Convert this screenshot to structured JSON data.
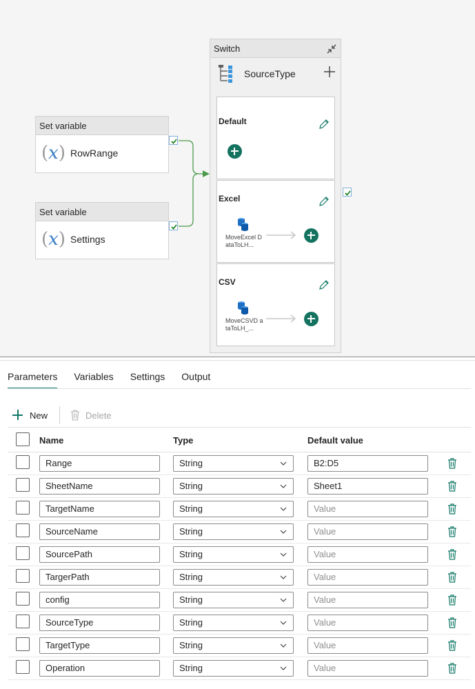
{
  "canvas": {
    "activities": [
      {
        "type_label": "Set variable",
        "name": "RowRange",
        "icon": "variable-icon"
      },
      {
        "type_label": "Set variable",
        "name": "Settings",
        "icon": "variable-icon"
      }
    ],
    "switch": {
      "type_label": "Switch",
      "expression": "SourceType",
      "cases": [
        {
          "title": "Default",
          "activity": ""
        },
        {
          "title": "Excel",
          "activity": "MoveExcel DataToLH..."
        },
        {
          "title": "CSV",
          "activity": "MoveCSVD ataToLH_..."
        }
      ]
    }
  },
  "tabs": [
    {
      "label": "Parameters",
      "active": true
    },
    {
      "label": "Variables",
      "active": false
    },
    {
      "label": "Settings",
      "active": false
    },
    {
      "label": "Output",
      "active": false
    }
  ],
  "toolbar": {
    "new_label": "New",
    "delete_label": "Delete"
  },
  "table": {
    "headers": {
      "name": "Name",
      "type": "Type",
      "default": "Default value"
    },
    "placeholder": "Value",
    "rows": [
      {
        "name": "Range",
        "type": "String",
        "default": "B2:D5"
      },
      {
        "name": "SheetName",
        "type": "String",
        "default": "Sheet1"
      },
      {
        "name": "TargetName",
        "type": "String",
        "default": ""
      },
      {
        "name": "SourceName",
        "type": "String",
        "default": ""
      },
      {
        "name": "SourcePath",
        "type": "String",
        "default": ""
      },
      {
        "name": "TargerPath",
        "type": "String",
        "default": ""
      },
      {
        "name": "config",
        "type": "String",
        "default": ""
      },
      {
        "name": "SourceType",
        "type": "String",
        "default": ""
      },
      {
        "name": "TargetType",
        "type": "String",
        "default": ""
      },
      {
        "name": "Operation",
        "type": "String",
        "default": ""
      }
    ]
  },
  "colors": {
    "accent": "#117865",
    "success": "#107c10",
    "canvas_bg": "#f5f5f5"
  }
}
